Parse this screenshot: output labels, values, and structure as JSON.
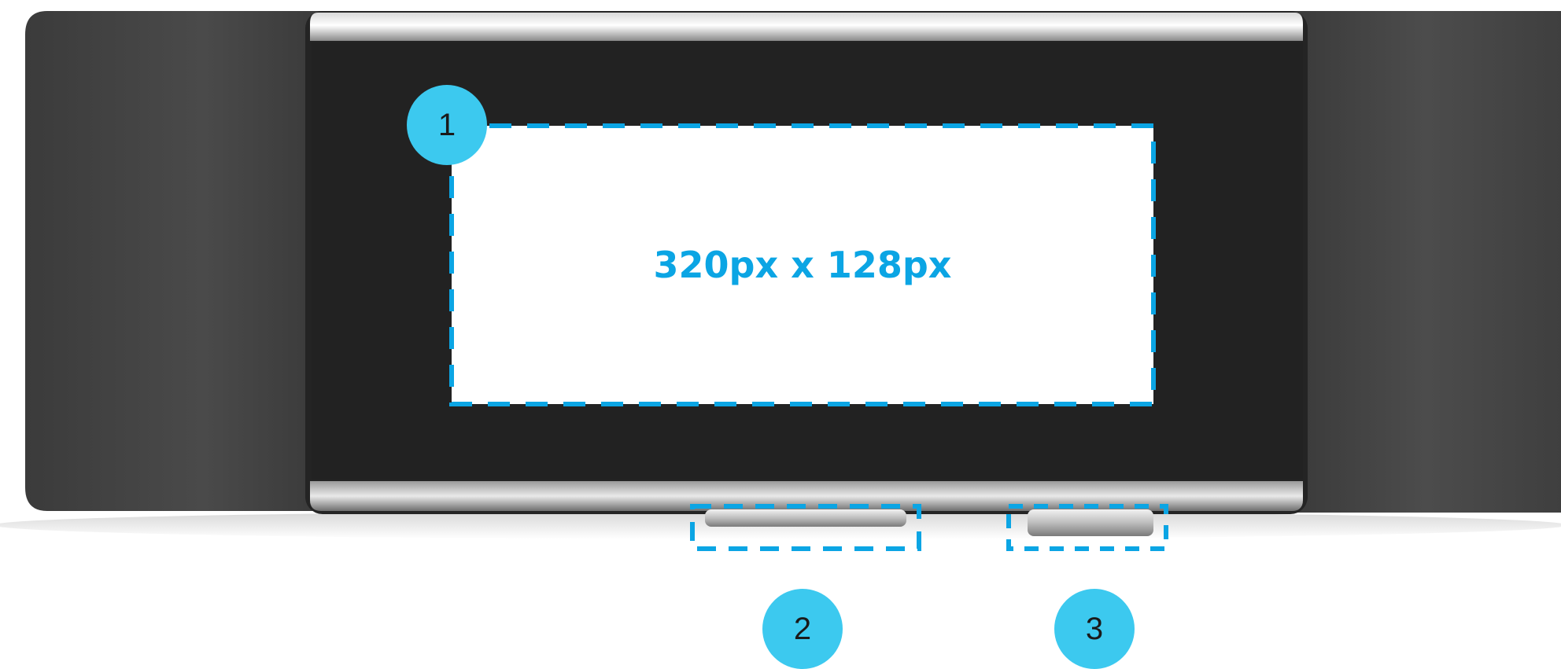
{
  "diagram": {
    "screen_label": "320px x 128px",
    "callouts": [
      {
        "number": "1",
        "target": "screen-area"
      },
      {
        "number": "2",
        "target": "action-button"
      },
      {
        "number": "3",
        "target": "power-button"
      }
    ]
  },
  "colors": {
    "accent": "#0ba5e4",
    "callout_fill": "#3cc9ef",
    "band": "#3a3a3a",
    "screen_bezel": "#222222",
    "screen_area": "#ffffff"
  }
}
